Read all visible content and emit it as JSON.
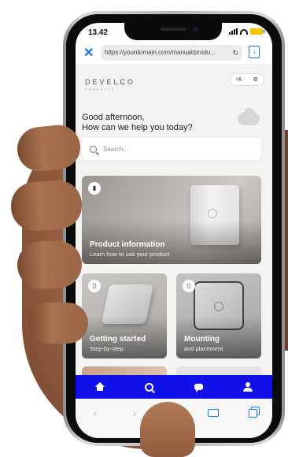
{
  "status": {
    "time": "13.42"
  },
  "browser": {
    "url": "https://yourdomain.com/manual/produ..."
  },
  "brand": {
    "logo": "DEVELCO",
    "logo_sub": "PRODUCTS"
  },
  "greeting": {
    "line1": "Good afternoon,",
    "line2": "How can we help you today?"
  },
  "search": {
    "placeholder": "Search..."
  },
  "cards": [
    {
      "title": "Product information",
      "subtitle": "Learn how to use your product"
    },
    {
      "title": "Getting started",
      "subtitle": "Step-by-step"
    },
    {
      "title": "Mounting",
      "subtitle": "and placement"
    }
  ],
  "bottom_nav": [
    "home-icon",
    "search-icon",
    "chat-icon",
    "user-icon"
  ],
  "toolbar": [
    "back-icon",
    "forward-icon",
    "share-icon",
    "bookmarks-icon",
    "tabs-icon"
  ],
  "colors": {
    "nav_bg": "#1010e8",
    "accent": "#1a73e8"
  }
}
